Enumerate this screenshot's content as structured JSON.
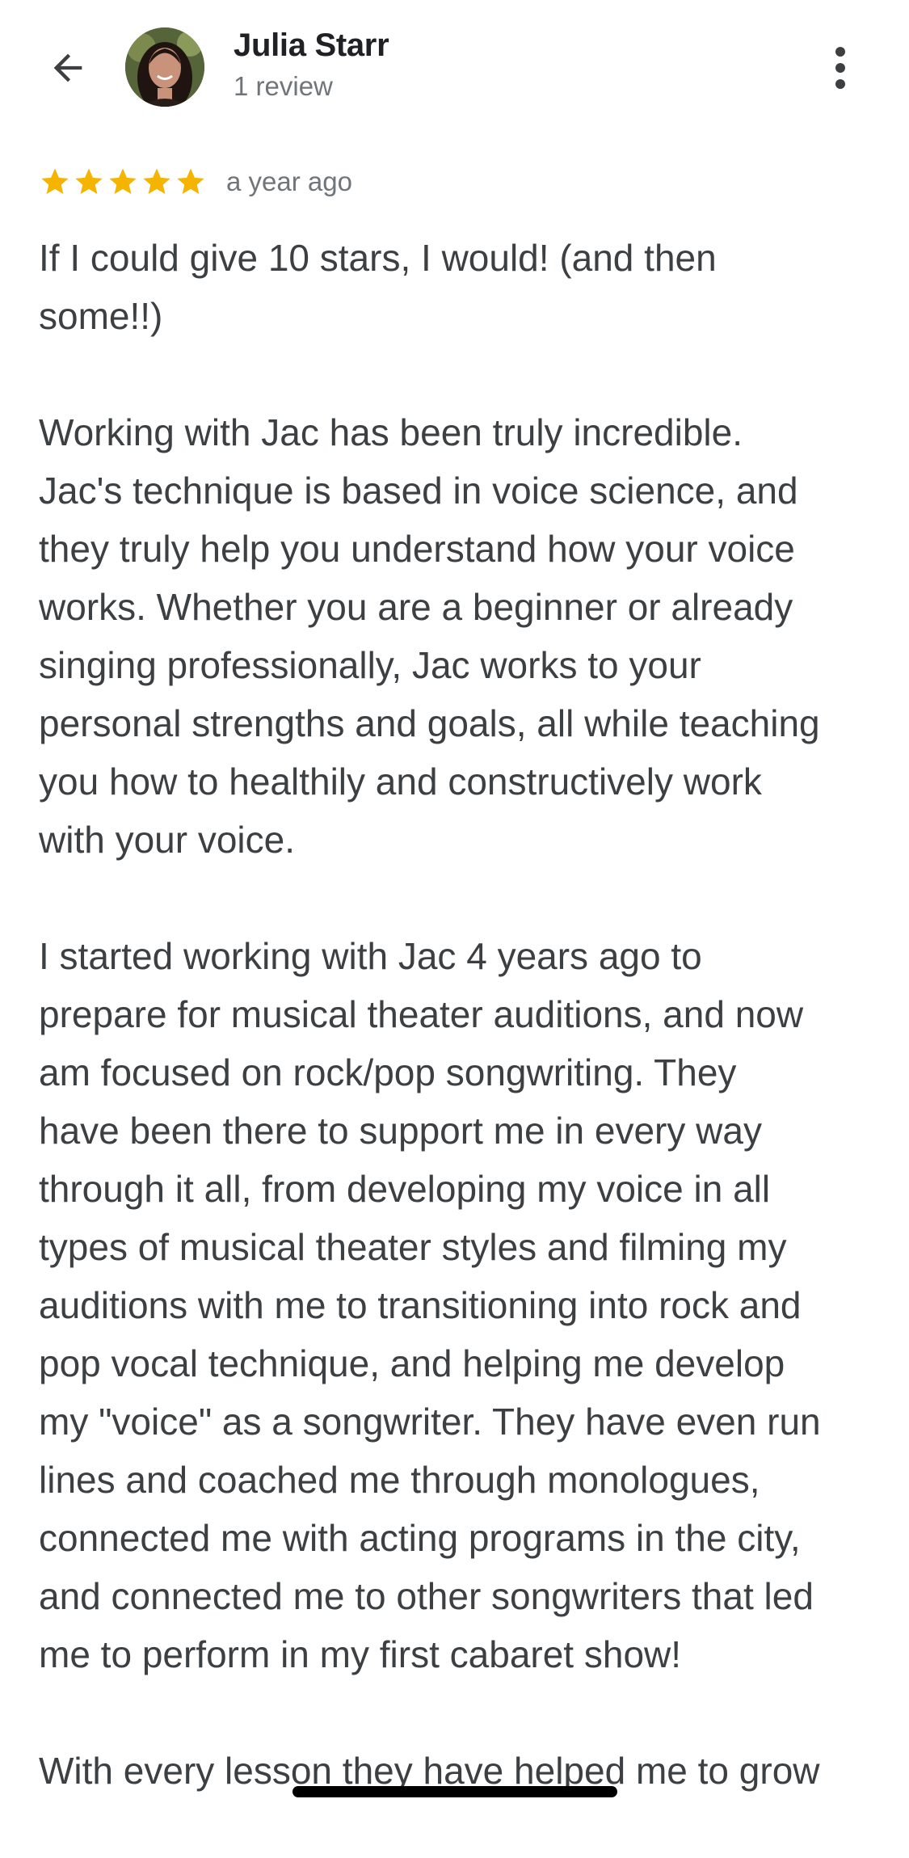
{
  "header": {
    "reviewer_name": "Julia Starr",
    "review_count": "1 review",
    "back_icon": "arrow-back-icon",
    "more_icon": "more-vert-icon"
  },
  "review": {
    "rating": 5,
    "rating_max": 5,
    "star_color": "#F4B400",
    "timestamp": "a year ago",
    "paragraphs": [
      "If I could give 10 stars, I would! (and then\nsome!!)",
      "Working with Jac has been truly incredible.\nJac's technique is based in voice science, and\nthey truly help you understand how your voice\nworks. Whether you are a beginner or already\nsinging professionally, Jac works to your\npersonal strengths and goals, all while teaching\nyou how to healthily and constructively work\nwith your voice.",
      "I started working with Jac 4 years ago to\nprepare for musical theater auditions, and now\nam focused on rock/pop songwriting. They\nhave been there to support me in every way\nthrough it all, from developing my voice in all\ntypes of musical theater styles and filming my\nauditions with me to transitioning into rock and\npop vocal technique, and helping me develop\nmy \"voice\" as a songwriter. They have even run\nlines and coached me through monologues,\nconnected me with acting programs in the city,\nand connected me to other songwriters that led\nme to perform in my first cabaret show!",
      "With every lesson they have helped me to grow"
    ]
  }
}
